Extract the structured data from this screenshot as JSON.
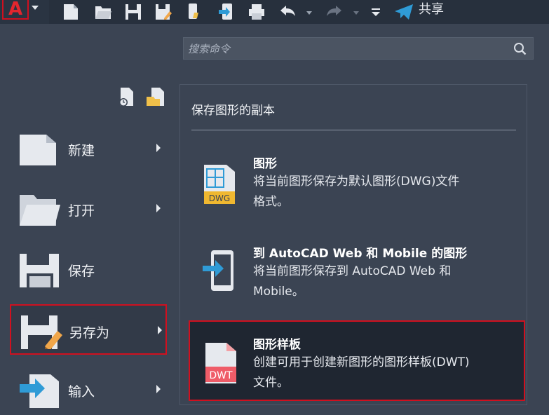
{
  "toolbar": {
    "share_label": "共享"
  },
  "search": {
    "placeholder": "搜索命令"
  },
  "left_menu": {
    "items": [
      {
        "label": "新建",
        "has_submenu": true
      },
      {
        "label": "打开",
        "has_submenu": true
      },
      {
        "label": "保存",
        "has_submenu": false
      },
      {
        "label": "另存为",
        "has_submenu": true,
        "selected": true
      },
      {
        "label": "输入",
        "has_submenu": true
      }
    ]
  },
  "submenu": {
    "title": "保存图形的副本",
    "options": [
      {
        "title": "图形",
        "desc_line1": "将当前图形保存为默认图形(DWG)文件",
        "desc_line2": "格式。",
        "icon": "dwg-file-icon",
        "icon_text": "DWG"
      },
      {
        "title": "到 AutoCAD Web 和 Mobile 的图形",
        "desc_line1": "将当前图形保存到 AutoCAD Web 和",
        "desc_line2": "Mobile。",
        "icon": "mobile-device-icon"
      },
      {
        "title": "图形样板",
        "desc_line1": "创建可用于创建新图形的图形样板(DWT)",
        "desc_line2": "文件。",
        "icon": "dwt-file-icon",
        "icon_text": "DWT",
        "highlighted": true
      }
    ]
  },
  "colors": {
    "background": "#3b4453",
    "toolbar": "#27303d",
    "highlight_border": "#d0101f",
    "accent_blue": "#2f9bd6"
  }
}
